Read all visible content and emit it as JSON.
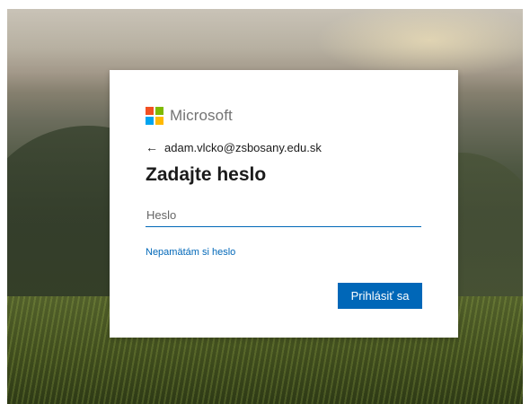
{
  "brand": {
    "name": "Microsoft",
    "logo_colors": [
      "#f25022",
      "#7fba00",
      "#00a4ef",
      "#ffb900"
    ]
  },
  "identity": {
    "back_icon": "back-arrow-icon",
    "back_glyph": "←",
    "email": "adam.vlcko@zsbosany.edu.sk"
  },
  "form": {
    "title": "Zadajte heslo",
    "password_placeholder": "Heslo",
    "password_value": "",
    "forgot_link": "Nepamätám si heslo",
    "submit_label": "Prihlásiť sa"
  },
  "colors": {
    "accent": "#0067b8",
    "text": "#1b1b1b",
    "brand_text": "#737373"
  }
}
